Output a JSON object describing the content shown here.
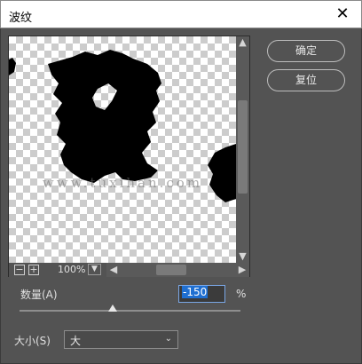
{
  "window": {
    "title": "波纹",
    "close_icon": "close-icon"
  },
  "preview": {
    "watermark": "www.tuxihan.com",
    "zoom_level": "100%"
  },
  "buttons": {
    "ok": "确定",
    "reset": "复位"
  },
  "amount": {
    "label": "数量(A)",
    "value": "-150",
    "unit": "%"
  },
  "size": {
    "label": "大小(S)",
    "selected": "大"
  },
  "slider": {
    "position_fraction": 0.42
  },
  "icons": {
    "zoom_out": "minus-icon",
    "zoom_in": "plus-icon",
    "dropdown": "chevron-down-icon",
    "scroll_up": "arrow-up-icon",
    "scroll_down": "arrow-down-icon",
    "scroll_left": "arrow-left-icon",
    "scroll_right": "arrow-right-icon"
  },
  "colors": {
    "dialog_bg": "#535353",
    "input_focus": "#7aa7e6",
    "selection": "#1f6fd1"
  }
}
